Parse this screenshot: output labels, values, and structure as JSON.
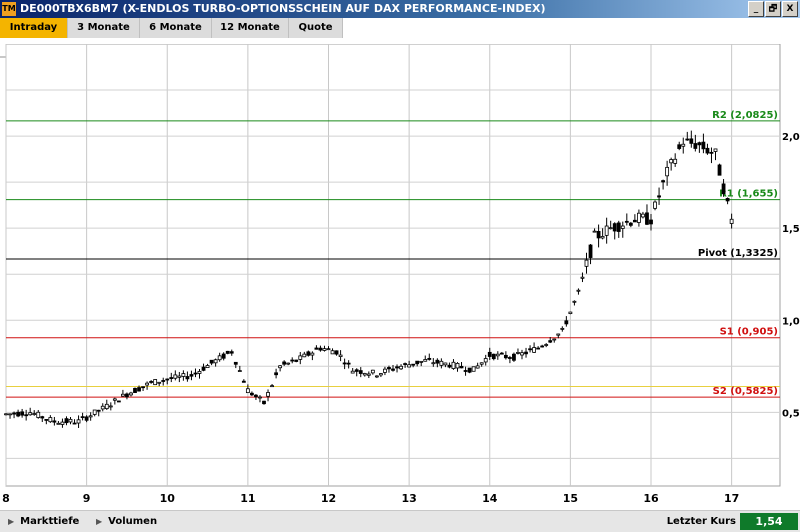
{
  "window": {
    "app_icon": "TM",
    "title": "DE000TBX6BM7 (X-ENDLOS TURBO-OPTIONSSCHEIN AUF DAX PERFORMANCE-INDEX)",
    "controls": [
      "_",
      "🗗",
      "X"
    ]
  },
  "tabs": [
    {
      "label": "Intraday",
      "active": true
    },
    {
      "label": "3 Monate",
      "active": false
    },
    {
      "label": "6 Monate",
      "active": false
    },
    {
      "label": "12 Monate",
      "active": false
    },
    {
      "label": "Quote",
      "active": false
    }
  ],
  "bottom": {
    "markttiefe": "Markttiefe",
    "volumen": "Volumen",
    "letzter_kurs_label": "Letzter Kurs",
    "letzter_kurs_value": "1,54"
  },
  "chart_data": {
    "type": "candlestick",
    "x_ticks": [
      "8",
      "9",
      "10",
      "11",
      "12",
      "13",
      "14",
      "15",
      "16",
      "17"
    ],
    "y_ticks": [
      {
        "value": 0.5,
        "label": "0,5"
      },
      {
        "value": 1.0,
        "label": "1,0"
      },
      {
        "value": 1.5,
        "label": "1,5"
      },
      {
        "value": 2.0,
        "label": "2,0"
      }
    ],
    "y_range": [
      0.1,
      2.5
    ],
    "levels": [
      {
        "name": "R2",
        "label": "R2 (2,0825)",
        "value": 2.0825,
        "color": "#1a8a1a"
      },
      {
        "name": "R1",
        "label": "R1 (1,655)",
        "value": 1.655,
        "color": "#1a8a1a"
      },
      {
        "name": "Pivot",
        "label": "Pivot (1,3325)",
        "value": 1.3325,
        "color": "#000000"
      },
      {
        "name": "S1",
        "label": "S1 (0,905)",
        "value": 0.905,
        "color": "#d01010"
      },
      {
        "name": "S2",
        "label": "S2 (0,5825)",
        "value": 0.5825,
        "color": "#d01010"
      }
    ],
    "yellow_level": 0.64,
    "price_path": [
      [
        8.0,
        0.49
      ],
      [
        8.3,
        0.5
      ],
      [
        8.6,
        0.45
      ],
      [
        8.9,
        0.45
      ],
      [
        9.2,
        0.52
      ],
      [
        9.5,
        0.6
      ],
      [
        9.8,
        0.66
      ],
      [
        10.0,
        0.68
      ],
      [
        10.3,
        0.7
      ],
      [
        10.6,
        0.78
      ],
      [
        10.8,
        0.83
      ],
      [
        11.0,
        0.62
      ],
      [
        11.2,
        0.55
      ],
      [
        11.4,
        0.75
      ],
      [
        11.6,
        0.78
      ],
      [
        11.9,
        0.85
      ],
      [
        12.1,
        0.83
      ],
      [
        12.3,
        0.73
      ],
      [
        12.6,
        0.71
      ],
      [
        12.9,
        0.75
      ],
      [
        13.2,
        0.78
      ],
      [
        13.5,
        0.76
      ],
      [
        13.8,
        0.73
      ],
      [
        14.0,
        0.81
      ],
      [
        14.3,
        0.8
      ],
      [
        14.6,
        0.85
      ],
      [
        14.9,
        0.94
      ],
      [
        15.1,
        1.15
      ],
      [
        15.3,
        1.45
      ],
      [
        15.5,
        1.5
      ],
      [
        15.8,
        1.55
      ],
      [
        16.0,
        1.55
      ],
      [
        16.2,
        1.8
      ],
      [
        16.4,
        1.97
      ],
      [
        16.6,
        1.95
      ],
      [
        16.8,
        1.9
      ],
      [
        17.0,
        1.54
      ]
    ]
  }
}
